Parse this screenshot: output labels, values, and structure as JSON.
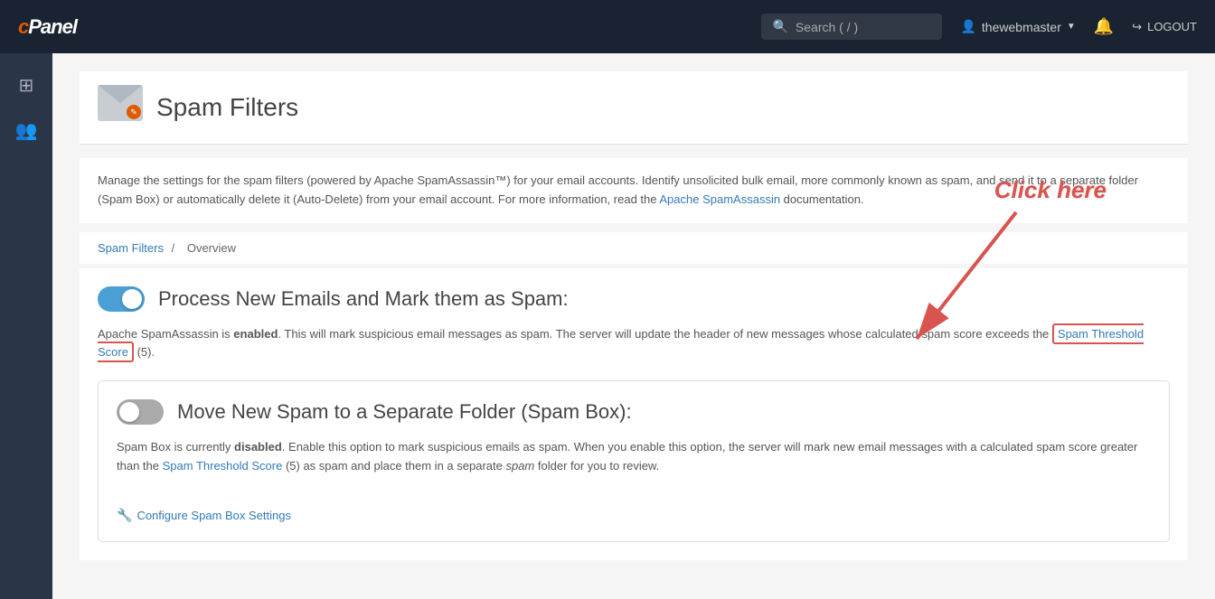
{
  "topnav": {
    "logo": "cPanel",
    "search_placeholder": "Search ( / )",
    "username": "thewebmaster",
    "logout_label": "LOGOUT"
  },
  "sidebar": {
    "items": [
      {
        "icon": "⊞",
        "label": "grid-icon"
      },
      {
        "icon": "👥",
        "label": "users-icon"
      }
    ]
  },
  "page": {
    "title": "Spam Filters",
    "description_part1": "Manage the settings for the spam filters (powered by Apache SpamAssassin™) for your email accounts. Identify unsolicited bulk email, more commonly known as spam, and send it to a separate folder (Spam Box) or automatically delete it (Auto-Delete) from your email account. For more information, read the ",
    "description_link": "Apache SpamAssassin",
    "description_part2": " documentation.",
    "breadcrumb_link": "Spam Filters",
    "breadcrumb_separator": "/",
    "breadcrumb_current": "Overview"
  },
  "section1": {
    "title": "Process New Emails and Mark them as Spam:",
    "toggle_state": "on",
    "desc_part1": "Apache SpamAssassin is ",
    "desc_bold": "enabled",
    "desc_part2": ". This will mark suspicious email messages as spam. The server will update the header of new messages whose calculated spam score exceeds the ",
    "threshold_link": "Spam Threshold Score",
    "threshold_value": " (5).",
    "annotation": "Click here"
  },
  "section2": {
    "title": "Move New Spam to a Separate Folder (Spam Box):",
    "toggle_state": "off",
    "desc_part1": "Spam Box is currently ",
    "desc_bold": "disabled",
    "desc_part2": ". Enable this option to mark suspicious emails as spam. When you enable this option, the server will mark new email messages with a calculated spam score greater than the ",
    "threshold_link": "Spam Threshold Score",
    "threshold_value": " (5) as spam and place them in a separate ",
    "italic_text": "spam",
    "desc_end": " folder for you to review.",
    "configure_label": "Configure Spam Box Settings",
    "threshold_score_label": "Threshold Score"
  }
}
